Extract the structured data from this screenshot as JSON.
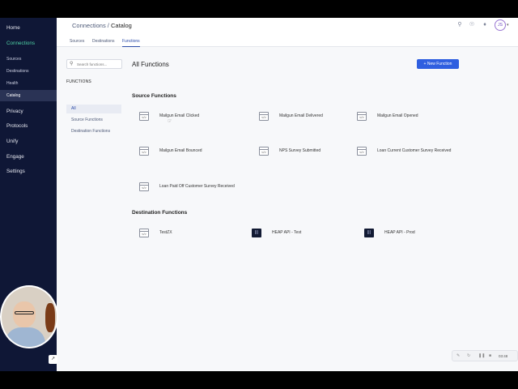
{
  "sidebar": {
    "items": [
      {
        "label": "Home"
      },
      {
        "label": "Connections"
      },
      {
        "label": "Sources"
      },
      {
        "label": "Destinations"
      },
      {
        "label": "Health"
      },
      {
        "label": "Catalog"
      },
      {
        "label": "Privacy"
      },
      {
        "label": "Protocols"
      },
      {
        "label": "Unify"
      },
      {
        "label": "Engage"
      },
      {
        "label": "Settings"
      }
    ]
  },
  "header": {
    "breadcrumb_parent": "Connections",
    "breadcrumb_sep": "/",
    "breadcrumb_current": "Catalog",
    "avatar_initials": "JS"
  },
  "tabs": [
    {
      "label": "Sources"
    },
    {
      "label": "Destinations"
    },
    {
      "label": "Functions"
    }
  ],
  "filters": {
    "search_placeholder": "Search functions...",
    "heading": "FUNCTIONS",
    "items": [
      {
        "label": "All"
      },
      {
        "label": "Source Functions"
      },
      {
        "label": "Destination Functions"
      }
    ]
  },
  "main": {
    "title": "All Functions",
    "new_button": "+  New Function",
    "source_section": "Source Functions",
    "destination_section": "Destination Functions",
    "source_functions": [
      {
        "label": "Mailgun Email Clicked"
      },
      {
        "label": "Mailgun Email Delivered"
      },
      {
        "label": "Mailgun Email Opened"
      },
      {
        "label": "Mailgun Email Bounced"
      },
      {
        "label": "NPS Survey Submitted"
      },
      {
        "label": "Loan Current Customer Survey Received"
      },
      {
        "label": "Loan Paid Off Customer Survey Received"
      }
    ],
    "destination_functions": [
      {
        "label": "TestZX"
      },
      {
        "label": "HEAP API - Test"
      },
      {
        "label": "HEAP API - Prod"
      }
    ]
  },
  "recorder": {
    "time": "03:48"
  }
}
